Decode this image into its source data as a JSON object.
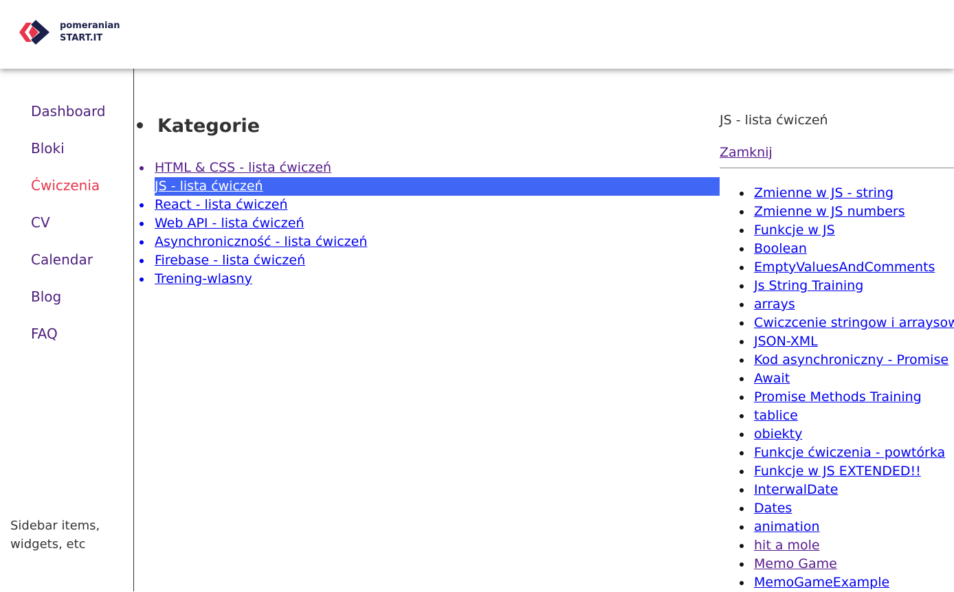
{
  "header": {
    "logo_line1": "pomeranian",
    "logo_line2": "START.IT",
    "colors": {
      "logo_red": "#e8354a",
      "logo_navy": "#1b1f4a"
    }
  },
  "page": {
    "title": "Ćwiczenia"
  },
  "sidebar": {
    "items": [
      {
        "label": "Dashboard"
      },
      {
        "label": "Bloki"
      },
      {
        "label": "Ćwiczenia",
        "active": true
      },
      {
        "label": "CV"
      },
      {
        "label": "Calendar"
      },
      {
        "label": "Blog"
      },
      {
        "label": "FAQ"
      }
    ],
    "note": "Sidebar items, widgets, etc",
    "colors": {
      "item": "#4b1d7a",
      "active": "#e8354a"
    }
  },
  "categories": {
    "heading": "Kategorie",
    "items": [
      {
        "label": "HTML & CSS - lista ćwiczeń",
        "visited": true
      },
      {
        "label": "JS - lista ćwiczeń",
        "selected": true
      },
      {
        "label": "React - lista ćwiczeń"
      },
      {
        "label": "Web API - lista ćwiczeń"
      },
      {
        "label": "Asynchroniczność - lista ćwiczeń"
      },
      {
        "label": "Firebase - lista ćwiczeń"
      },
      {
        "label": "Trening-wlasny"
      }
    ],
    "colors": {
      "selected_bg": "#4066f5",
      "link": "#0000ee",
      "visited": "#551a8b"
    }
  },
  "exercises": {
    "title": "JS - lista ćwiczeń",
    "close_label": "Zamknij",
    "items": [
      {
        "label": "Zmienne w JS - string"
      },
      {
        "label": "Zmienne w JS numbers"
      },
      {
        "label": "Funkcje w JS"
      },
      {
        "label": "Boolean"
      },
      {
        "label": "EmptyValuesAndComments"
      },
      {
        "label": "Js String Training"
      },
      {
        "label": "arrays"
      },
      {
        "label": "Cwiczcenie stringow i arraysow"
      },
      {
        "label": "JSON-XML"
      },
      {
        "label": "Kod asynchroniczny - Promise"
      },
      {
        "label": "Await"
      },
      {
        "label": "Promise Methods Training"
      },
      {
        "label": "tablice"
      },
      {
        "label": "obiekty"
      },
      {
        "label": "Funkcje ćwiczenia - powtórka"
      },
      {
        "label": "Funkcje w JS EXTENDED!!"
      },
      {
        "label": "InterwalDate"
      },
      {
        "label": "Dates"
      },
      {
        "label": "animation"
      },
      {
        "label": "hit a mole",
        "visited": true
      },
      {
        "label": "Memo Game",
        "visited": true
      },
      {
        "label": "MemoGameExample"
      }
    ]
  }
}
